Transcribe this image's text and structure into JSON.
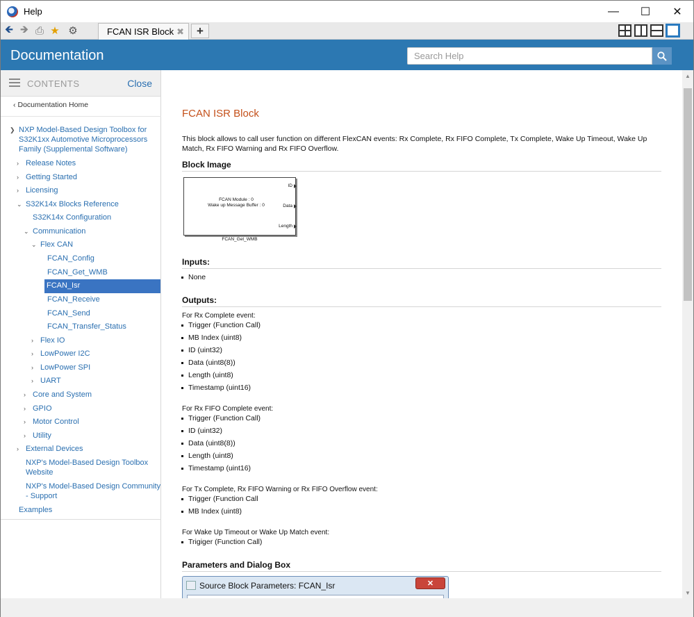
{
  "window": {
    "title": "Help"
  },
  "toolbar": {
    "tab_label": "FCAN ISR Block",
    "add_tab_label": "+",
    "tab_close_label": "✖"
  },
  "header": {
    "title": "Documentation",
    "search_placeholder": "Search Help"
  },
  "sidebar": {
    "contents_label": "CONTENTS",
    "close_label": "Close",
    "doc_home": "Documentation Home",
    "items": [
      {
        "label": "NXP Model-Based Design Toolbox for",
        "arrow": "expanded"
      },
      {
        "label": "S32K1xx Automotive Microprocessors"
      },
      {
        "label": "Family (Supplemental Software)"
      },
      {
        "label": "Release Notes",
        "arrow": "collapsed"
      },
      {
        "label": "Getting Started",
        "arrow": "collapsed"
      },
      {
        "label": "Licensing",
        "arrow": "collapsed"
      },
      {
        "label": "S32K14x Blocks Reference",
        "arrow": "expanded"
      },
      {
        "label": "S32K14x Configuration"
      },
      {
        "label": "Communication",
        "arrow": "expanded"
      },
      {
        "label": "Flex CAN",
        "arrow": "expanded"
      },
      {
        "label": "FCAN_Config"
      },
      {
        "label": "FCAN_Get_WMB"
      },
      {
        "label": "FCAN_Isr",
        "selected": true
      },
      {
        "label": "FCAN_Receive"
      },
      {
        "label": "FCAN_Send"
      },
      {
        "label": "FCAN_Transfer_Status"
      },
      {
        "label": "Flex IO",
        "arrow": "collapsed"
      },
      {
        "label": "LowPower I2C",
        "arrow": "collapsed"
      },
      {
        "label": "LowPower SPI",
        "arrow": "collapsed"
      },
      {
        "label": "UART",
        "arrow": "collapsed"
      },
      {
        "label": "Core and System",
        "arrow": "collapsed"
      },
      {
        "label": "GPIO",
        "arrow": "collapsed"
      },
      {
        "label": "Motor Control",
        "arrow": "collapsed"
      },
      {
        "label": "Utility",
        "arrow": "collapsed"
      },
      {
        "label": "External Devices",
        "arrow": "collapsed"
      },
      {
        "label": "NXP's Model-Based Design Toolbox"
      },
      {
        "label": "Website"
      },
      {
        "label": "NXP's Model-Based Design Community"
      },
      {
        "label": "- Support"
      },
      {
        "label": "Examples"
      }
    ]
  },
  "main": {
    "title": "FCAN ISR Block",
    "intro_line1": "This block allows to call user function on different FlexCAN events: Rx Complete, Rx FIFO Complete, Tx Complete, Wake Up Timeout, Wake Up",
    "intro_line2": "Match, Rx FIFO Warning and Rx FIFO Overflow.",
    "block_image_heading": "Block Image",
    "block": {
      "line1": "FCAN Module : 0",
      "line2": "Wake up Message Buffer : 0",
      "port_id": "ID",
      "port_data": "Data",
      "port_length": "Length",
      "name": "FCAN_Get_WMB"
    },
    "inputs_heading": "Inputs:",
    "inputs": [
      "None"
    ],
    "outputs_heading": "Outputs:",
    "groups": [
      {
        "title": "For Rx Complete event:",
        "items": [
          "Trigger (Function Call)",
          "MB Index (uint8)",
          "ID (uint32)",
          "Data (uint8(8))",
          "Length (uint8)",
          "Timestamp (uint16)"
        ]
      },
      {
        "title": "For Rx FIFO Complete event:",
        "items": [
          "Trigger (Function Call)",
          "ID (uint32)",
          "Data (uint8(8))",
          "Length (uint8)",
          "Timestamp (uint16)"
        ]
      },
      {
        "title": "For Tx Complete, Rx FIFO Warning or Rx FIFO Overflow event:",
        "items": [
          "Trigger (Function Call",
          "MB Index (uint8)"
        ]
      },
      {
        "title": "For Wake Up Timeout or Wake Up Match event:",
        "items": [
          "Trigiger (Function Call)"
        ]
      }
    ],
    "params_heading": "Parameters and Dialog Box",
    "dialog_title": "Source Block Parameters: FCAN_Isr"
  }
}
